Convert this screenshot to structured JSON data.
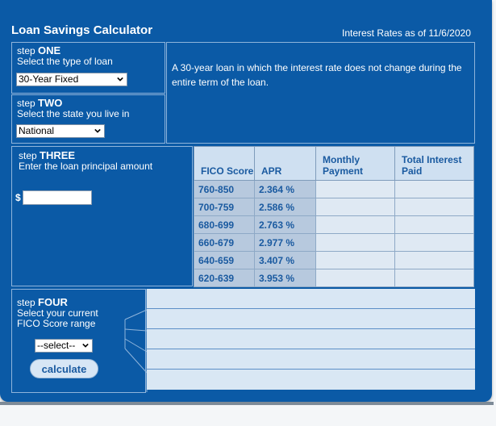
{
  "header": {
    "title": "Loan Savings Calculator",
    "rates_date": "Interest Rates as of 11/6/2020"
  },
  "step1": {
    "step_label": "step",
    "step_number": "ONE",
    "instruction": "Select the type of loan",
    "selected": "30-Year Fixed"
  },
  "step2": {
    "step_label": "step",
    "step_number": "TWO",
    "instruction": "Select the state you live in",
    "selected": "National"
  },
  "description": "A 30-year loan in which the interest rate does not change during the entire term of the loan.",
  "step3": {
    "step_label": "step",
    "step_number": "THREE",
    "instruction": "Enter the loan principal amount",
    "currency": "$",
    "principal_value": ""
  },
  "table": {
    "headers": {
      "fico": "FICO Score",
      "apr": "APR",
      "monthly": "Monthly Payment",
      "total": "Total Interest Paid"
    },
    "rows": [
      {
        "fico": "760-850",
        "apr": "2.364 %"
      },
      {
        "fico": "700-759",
        "apr": "2.586 %"
      },
      {
        "fico": "680-699",
        "apr": "2.763 %"
      },
      {
        "fico": "660-679",
        "apr": "2.977 %"
      },
      {
        "fico": "640-659",
        "apr": "3.407 %"
      },
      {
        "fico": "620-639",
        "apr": "3.953 %"
      }
    ]
  },
  "step4": {
    "step_label": "step",
    "step_number": "FOUR",
    "instruction": "Select your current FICO Score range",
    "selected": "--select--",
    "button": "calculate"
  },
  "colors": {
    "background": "#0b5aa6",
    "header_cell": "#cfe0f1",
    "data_cell": "#b7c9de",
    "text_accent": "#1a5aa0"
  }
}
